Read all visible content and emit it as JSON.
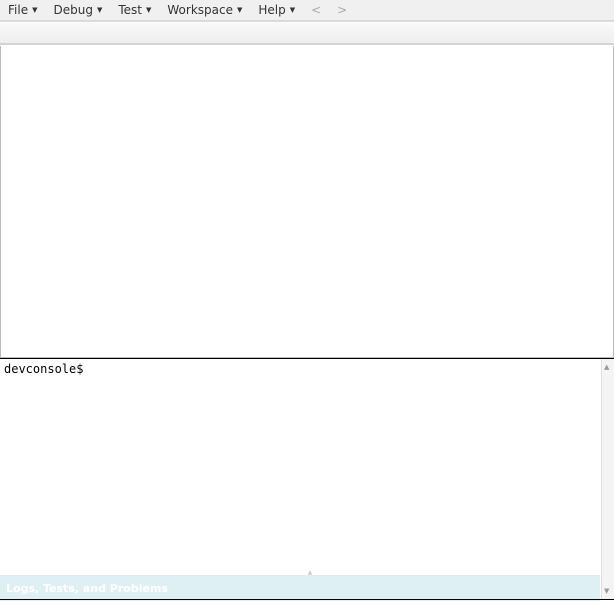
{
  "menu": [
    {
      "label": "File"
    },
    {
      "label": "Debug"
    },
    {
      "label": "Test"
    },
    {
      "label": "Workspace"
    },
    {
      "label": "Help"
    }
  ],
  "nav": {
    "back": "<",
    "forward": ">"
  },
  "console": {
    "prompt": "devconsole$"
  },
  "panel": {
    "title": "Logs, Tests, and Problems"
  }
}
